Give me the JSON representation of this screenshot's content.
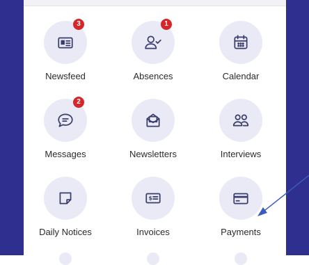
{
  "tiles": [
    {
      "label": "Newsfeed",
      "icon": "newspaper-icon",
      "badge": "3"
    },
    {
      "label": "Absences",
      "icon": "user-check-icon",
      "badge": "1"
    },
    {
      "label": "Calendar",
      "icon": "calendar-icon"
    },
    {
      "label": "Messages",
      "icon": "chat-bubble-icon",
      "badge": "2"
    },
    {
      "label": "Newsletters",
      "icon": "envelope-open-icon"
    },
    {
      "label": "Interviews",
      "icon": "people-icon"
    },
    {
      "label": "Daily Notices",
      "icon": "sticky-note-icon"
    },
    {
      "label": "Invoices",
      "icon": "invoice-icon"
    },
    {
      "label": "Payments",
      "icon": "credit-card-icon"
    }
  ],
  "colors": {
    "frame": "#2f2f8f",
    "icon_stroke": "#3a3d6b",
    "icon_bg": "#e9eaf6",
    "badge": "#d6262a",
    "arrow": "#3a5bbf"
  }
}
